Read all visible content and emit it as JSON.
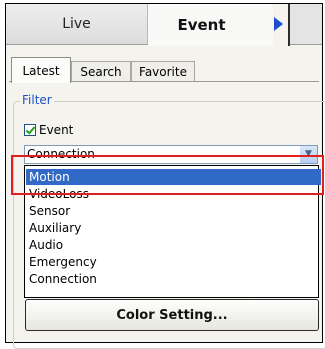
{
  "top_tabs": {
    "live_label": "Live",
    "event_label": "Event",
    "scroll_arrow_icon": "triangle-right-icon",
    "arrow_color": "#1a4fc9"
  },
  "sub_tabs": [
    {
      "label": "Latest",
      "active": true
    },
    {
      "label": "Search",
      "active": false
    },
    {
      "label": "Favorite",
      "active": false
    }
  ],
  "filter": {
    "title": "Filter",
    "title_color": "#1e50c8",
    "event_checkbox": {
      "label": "Event",
      "checked": true
    },
    "combo": {
      "selected_value": "Connection",
      "button_icon": "chevron-down-icon"
    },
    "dropdown_items": [
      {
        "label": "Motion",
        "selected": true
      },
      {
        "label": "VideoLoss",
        "selected": false
      },
      {
        "label": "Sensor",
        "selected": false
      },
      {
        "label": "Auxiliary",
        "selected": false
      },
      {
        "label": "Audio",
        "selected": false
      },
      {
        "label": "Emergency",
        "selected": false
      },
      {
        "label": "Connection",
        "selected": false
      }
    ],
    "selection_color": "#3169c6"
  },
  "annotation": {
    "highlight_color": "#e02020"
  },
  "color_setting_button": {
    "label": "Color Setting..."
  }
}
